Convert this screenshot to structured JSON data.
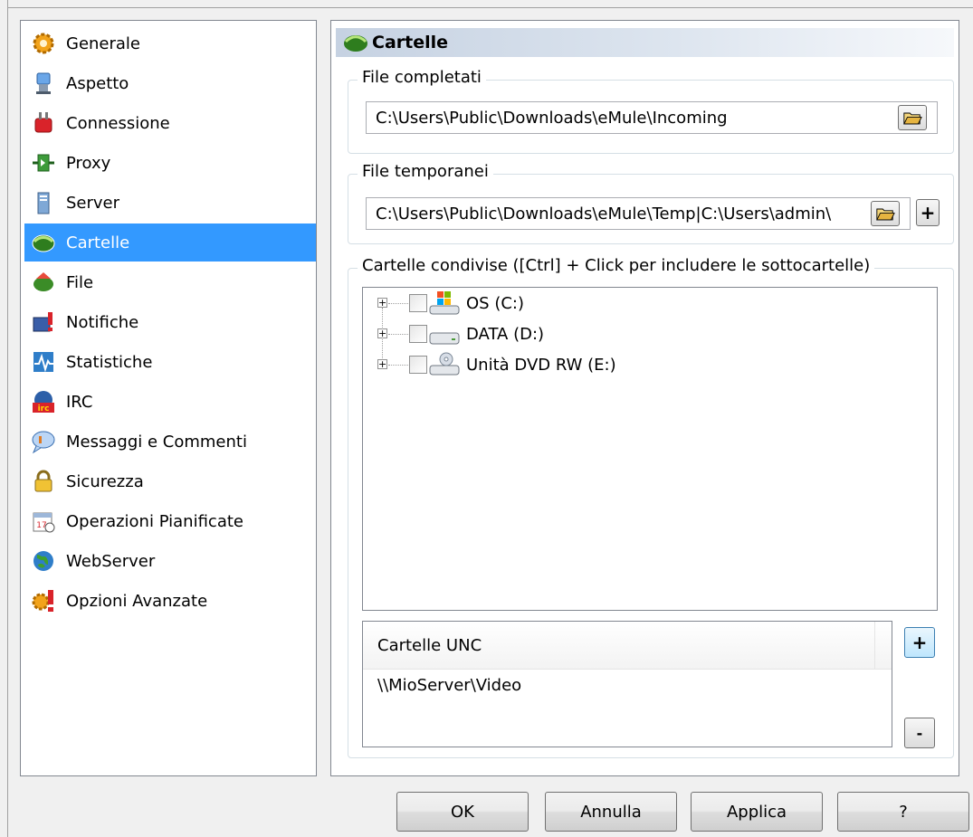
{
  "nav": {
    "items": [
      {
        "label": "Generale",
        "icon": "gear-icon"
      },
      {
        "label": "Aspetto",
        "icon": "appearance-icon"
      },
      {
        "label": "Connessione",
        "icon": "plug-icon"
      },
      {
        "label": "Proxy",
        "icon": "proxy-icon"
      },
      {
        "label": "Server",
        "icon": "server-icon"
      },
      {
        "label": "Cartelle",
        "icon": "folders-icon",
        "selected": true
      },
      {
        "label": "File",
        "icon": "file-icon"
      },
      {
        "label": "Notifiche",
        "icon": "notification-icon"
      },
      {
        "label": "Statistiche",
        "icon": "statistics-icon"
      },
      {
        "label": "IRC",
        "icon": "irc-icon"
      },
      {
        "label": "Messaggi e Commenti",
        "icon": "messages-icon"
      },
      {
        "label": "Sicurezza",
        "icon": "lock-icon"
      },
      {
        "label": "Operazioni Pianificate",
        "icon": "scheduler-icon"
      },
      {
        "label": "WebServer",
        "icon": "globe-icon"
      },
      {
        "label": "Opzioni Avanzate",
        "icon": "advanced-options-icon"
      }
    ]
  },
  "page": {
    "title": "Cartelle",
    "completed": {
      "legend": "File completati",
      "path": "C:\\Users\\Public\\Downloads\\eMule\\Incoming"
    },
    "temp": {
      "legend": "File temporanei",
      "path": "C:\\Users\\Public\\Downloads\\eMule\\Temp|C:\\Users\\admin\\",
      "add_label": "+"
    },
    "shared": {
      "legend": "Cartelle condivise ([Ctrl]  + Click per includere le sottocartelle)",
      "drives": [
        {
          "label": "OS (C:)",
          "icon": "system-drive-icon"
        },
        {
          "label": "DATA (D:)",
          "icon": "hard-drive-icon"
        },
        {
          "label": "Unità DVD RW (E:)",
          "icon": "dvd-drive-icon"
        }
      ]
    },
    "unc": {
      "header": "Cartelle UNC",
      "rows": [
        "\\\\MioServer\\Video"
      ],
      "add_label": "+",
      "remove_label": "-"
    }
  },
  "buttons": {
    "ok": "OK",
    "cancel": "Annulla",
    "apply": "Applica",
    "help": "?"
  },
  "colors": {
    "selection": "#3399ff",
    "header_gradient_start": "#c6d2e2"
  }
}
